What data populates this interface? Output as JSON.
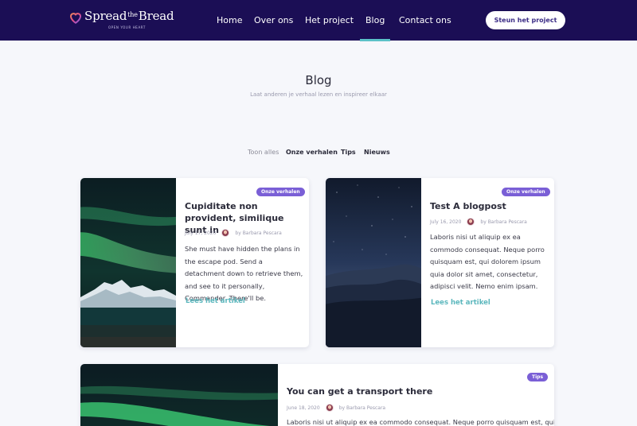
{
  "nav": {
    "logo_main": "Spread",
    "logo_mid": "the",
    "logo_end": "Bread",
    "logo_tagline": "OPEN YOUR HEART",
    "items": [
      {
        "label": "Home"
      },
      {
        "label": "Over ons"
      },
      {
        "label": "Het project"
      },
      {
        "label": "Blog"
      },
      {
        "label": "Contact ons"
      }
    ],
    "cta": "Steun het project",
    "accent": "#5bc2c8",
    "bg": "#1b0e55"
  },
  "header": {
    "title": "Blog",
    "subtitle": "Laat anderen je verhaal lezen en inspireer elkaar"
  },
  "filters": [
    {
      "label": "Toon alles"
    },
    {
      "label": "Onze verhalen"
    },
    {
      "label": "Tips"
    },
    {
      "label": "Nieuws"
    }
  ],
  "posts": [
    {
      "badge": "Onze verhalen",
      "title": "Cupiditate non provident, similique sunt in",
      "date": "July 17, 2020",
      "author": "by Barbara Pescara",
      "excerpt": "She must have hidden the plans in the escape pod. Send a detachment down to retrieve them, and see to it personally, Commander. There'll be.",
      "read_more": "Lees het artikel"
    },
    {
      "badge": "Onze verhalen",
      "title": "Test A blogpost",
      "date": "July 16, 2020",
      "author": "by Barbara Pescara",
      "excerpt": "Laboris nisi ut aliquip ex ea commodo consequat. Neque porro quisquam est, qui dolorem ipsum quia dolor sit amet, consectetur, adipisci velit. Nemo enim ipsam.",
      "read_more": "Lees het artikel"
    },
    {
      "badge": "Tips",
      "title": "You can get a transport there",
      "date": "June 18, 2020",
      "author": "by Barbara Pescara",
      "excerpt": "Laboris nisi ut aliquip ex ea commodo consequat. Neque porro quisquam est, qui"
    }
  ],
  "colors": {
    "badge": "#7a5fd6",
    "link": "#5bb7bd"
  }
}
